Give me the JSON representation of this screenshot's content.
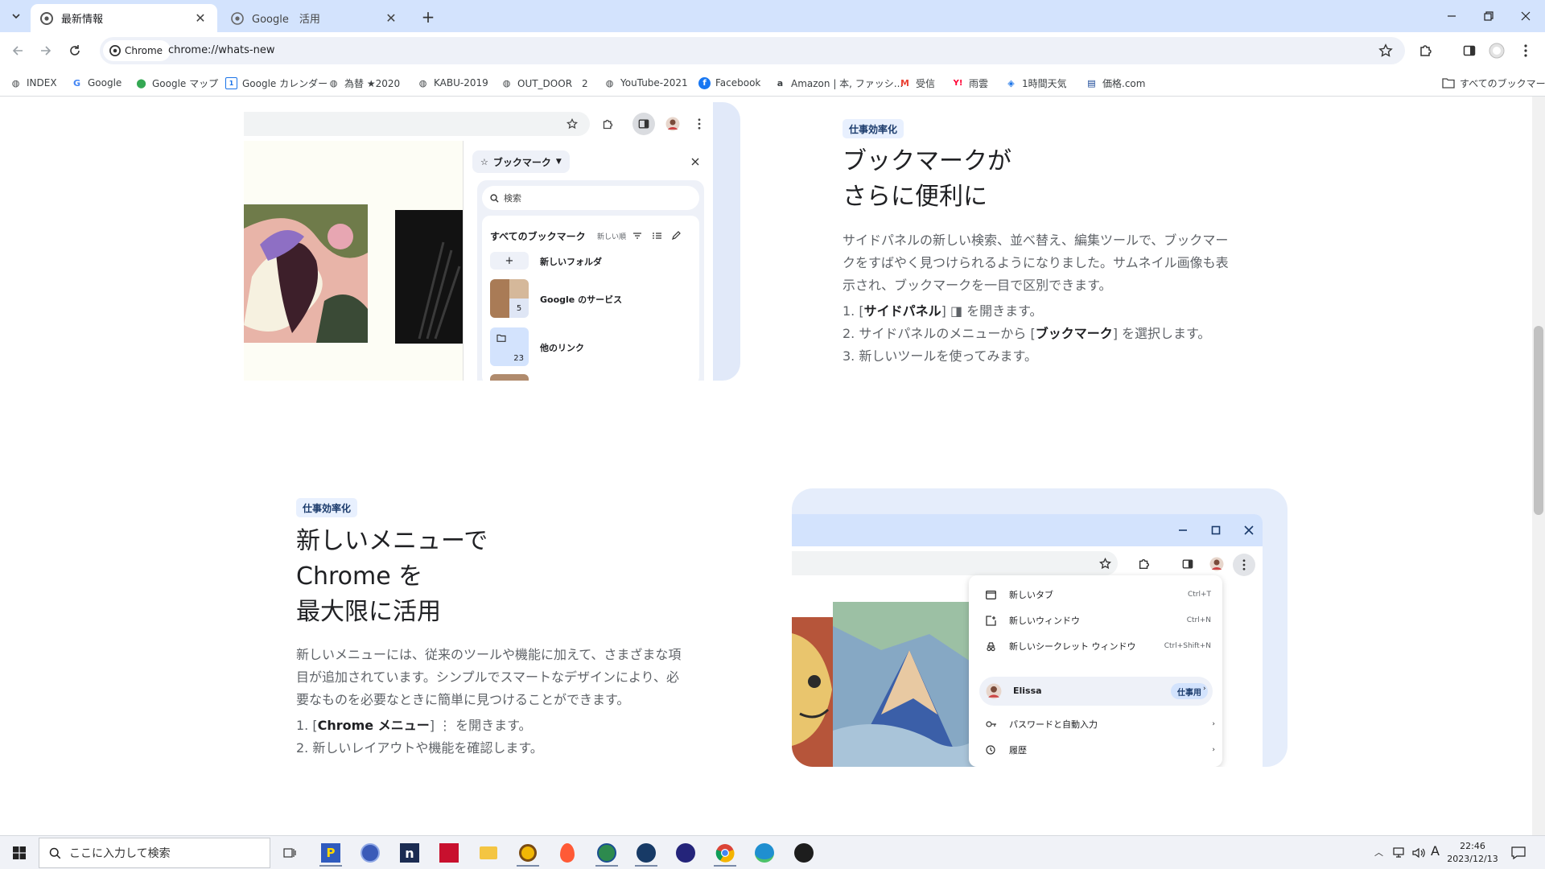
{
  "tabs": [
    {
      "title": "最新情報",
      "active": true
    },
    {
      "title": "Google　活用",
      "active": false
    }
  ],
  "omnibox": {
    "chip_label": "Chrome",
    "url": "chrome://whats-new"
  },
  "bookmarks": [
    {
      "label": "INDEX",
      "icon": "globe-icon"
    },
    {
      "label": "Google",
      "icon": "google-icon"
    },
    {
      "label": "Google マップ",
      "icon": "maps-icon"
    },
    {
      "label": "Google カレンダー",
      "icon": "calendar-icon"
    },
    {
      "label": "為替 ★2020",
      "icon": "globe-icon"
    },
    {
      "label": "KABU-2019",
      "icon": "globe-icon"
    },
    {
      "label": "OUT_DOOR　2",
      "icon": "globe-icon"
    },
    {
      "label": "YouTube-2021",
      "icon": "globe-icon"
    },
    {
      "label": "Facebook",
      "icon": "facebook-icon"
    },
    {
      "label": "Amazon | 本, ファッシ...",
      "icon": "amazon-icon"
    },
    {
      "label": "受信",
      "icon": "gmail-icon"
    },
    {
      "label": "雨雲",
      "icon": "yahoo-icon"
    },
    {
      "label": "1時間天気",
      "icon": "weather-icon"
    },
    {
      "label": "価格.com",
      "icon": "kakaku-icon"
    }
  ],
  "all_bookmarks": "すべてのブックマーク",
  "section1": {
    "badge": "仕事効率化",
    "title_line1": "ブックマークが",
    "title_line2": "さらに便利に",
    "para_line1": "サイドパネルの新しい検索、並べ替え、編集ツールで、ブックマー",
    "para_line2": "クをすばやく見つけられるようになりました。サムネイル画像も表",
    "para_line3": "示され、ブックマークを一目で区別できます。",
    "step1_pre": "1. [",
    "step1_bold": "サイドパネル",
    "step1_post": "] ◨ を開きます。",
    "step2_pre": "2. サイドパネルのメニューから [",
    "step2_bold": "ブックマーク",
    "step2_post": "] を選択します。",
    "step3": "3. 新しいツールを使ってみます。",
    "panel": {
      "title": "ブックマーク",
      "search_placeholder": "検索",
      "all_label": "すべてのブックマーク",
      "sort_label": "新しい順",
      "items": [
        {
          "label": "新しいフォルダ"
        },
        {
          "label": "Google のサービス",
          "count": "5"
        },
        {
          "label": "他のリンク",
          "count": "23"
        }
      ]
    }
  },
  "section2": {
    "badge": "仕事効率化",
    "title_line1": "新しいメニューで",
    "title_line2": "Chrome を",
    "title_line3": "最大限に活用",
    "para_line1": "新しいメニューには、従来のツールや機能に加えて、さまざまな項",
    "para_line2": "目が追加されています。シンプルでスマートなデザインにより、必",
    "para_line3": "要なものを必要なときに簡単に見つけることができます。",
    "step1_pre": "1. [",
    "step1_bold": "Chrome メニュー",
    "step1_post": "] ⋮ を開きます。",
    "step2": "2. 新しいレイアウトや機能を確認します。",
    "menu": [
      {
        "label": "新しいタブ",
        "shortcut": "Ctrl+T"
      },
      {
        "label": "新しいウィンドウ",
        "shortcut": "Ctrl+N"
      },
      {
        "label": "新しいシークレット ウィンドウ",
        "shortcut": "Ctrl+Shift+N"
      }
    ],
    "profile": {
      "name": "Elissa",
      "badge": "仕事用"
    },
    "menu2": [
      {
        "label": "パスワードと自動入力"
      },
      {
        "label": "履歴"
      }
    ]
  },
  "taskbar": {
    "search_placeholder": "ここに入力して検索",
    "time": "22:46",
    "date": "2023/12/13"
  },
  "colors": {
    "accent": "#1a73e8",
    "tab_strip": "#d3e3fd",
    "badge_bg": "#e8f0fe"
  }
}
